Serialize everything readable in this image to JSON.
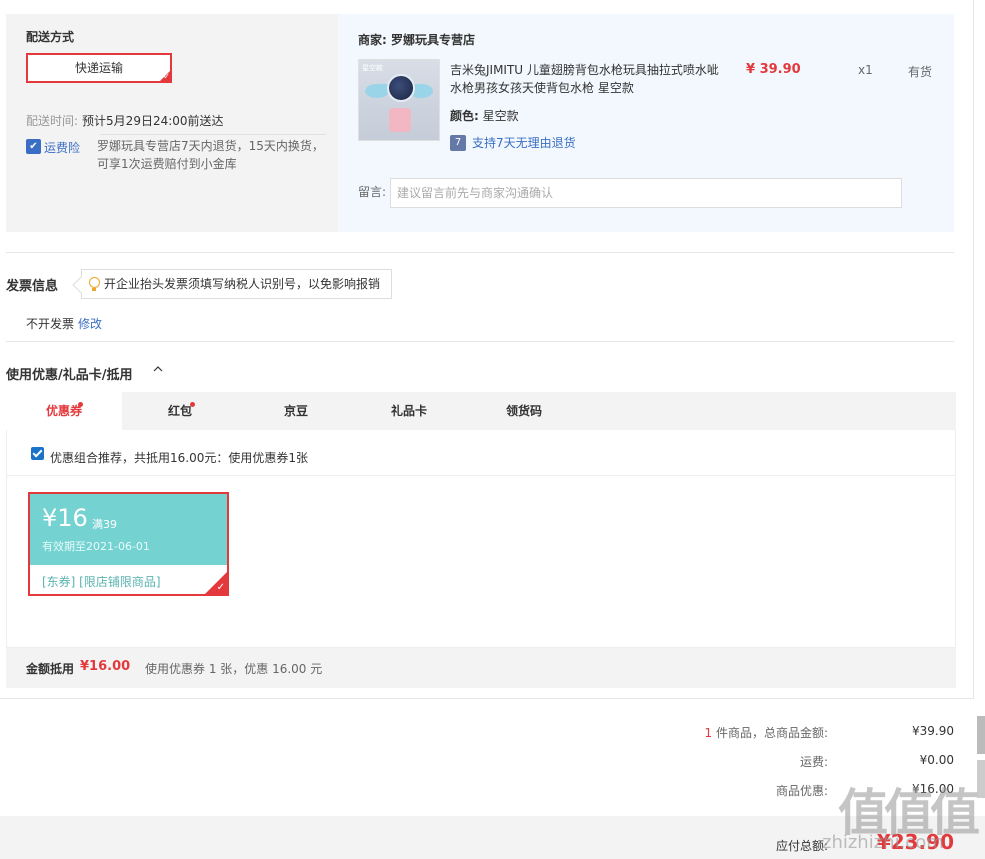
{
  "delivery": {
    "section_label": "配送方式",
    "option_label": "快递运输",
    "time_label": "配送时间:",
    "time_value": "预计5月29日24:00前送达",
    "insurance_icon": "shield-icon",
    "insurance_icon_glyph": "✔",
    "insurance_link": "运费险",
    "insurance_text": "罗娜玩具专营店7天内退货，15天内换货，可享1次运费赔付到小金库"
  },
  "goods": {
    "merchant_label": "商家:",
    "merchant_name": "罗娜玩具专营店",
    "thumb_tag": "星空款",
    "name": "吉米兔JIMITU 儿童翅膀背包水枪玩具抽拉式喷水呲水枪男孩女孩天使背包水枪 星空款",
    "price": "¥ 39.90",
    "quantity": "x1",
    "stock": "有货",
    "color_label": "颜色:",
    "color_value": "星空款",
    "return_icon_glyph": "7",
    "return_text": "支持7天无理由退货",
    "message_label": "留言:",
    "message_placeholder": "建议留言前先与商家沟通确认"
  },
  "invoice": {
    "title": "发票信息",
    "tip": "开企业抬头发票须填写纳税人识别号，以免影响报销",
    "status": "不开发票",
    "edit_link": "修改"
  },
  "coupons": {
    "title": "使用优惠/礼品卡/抵用",
    "tabs": [
      {
        "label": "优惠券",
        "dot": true
      },
      {
        "label": "红包",
        "dot": true
      },
      {
        "label": "京豆",
        "dot": false
      },
      {
        "label": "礼品卡",
        "dot": false
      },
      {
        "label": "领货码",
        "dot": false
      }
    ],
    "combo_text": "优惠组合推荐，共抵用16.00元：使用优惠券1张",
    "card": {
      "amount": "¥16",
      "condition": "满39",
      "valid": "有效期至2021-06-01",
      "tags": "[东券]  [限店铺限商品]"
    },
    "summary_label": "金额抵用",
    "summary_amount": "¥16.00",
    "summary_desc": "使用优惠券 1 张，优惠 16.00 元"
  },
  "totals": {
    "count": "1",
    "goods_label": "件商品，总商品金额:",
    "goods_value": "¥39.90",
    "freight_label": "运费:",
    "freight_value": "¥0.00",
    "discount_label": "商品优惠:",
    "discount_value": "¥16.00",
    "pay_label": "应付总额:",
    "pay_value": "¥23.90"
  },
  "watermark": {
    "logo": "值值值",
    "site": "zhizhizhi.com"
  },
  "colors": {
    "accent": "#e4393c",
    "link": "#3a6ec4",
    "coupon": "#74d2d1"
  }
}
